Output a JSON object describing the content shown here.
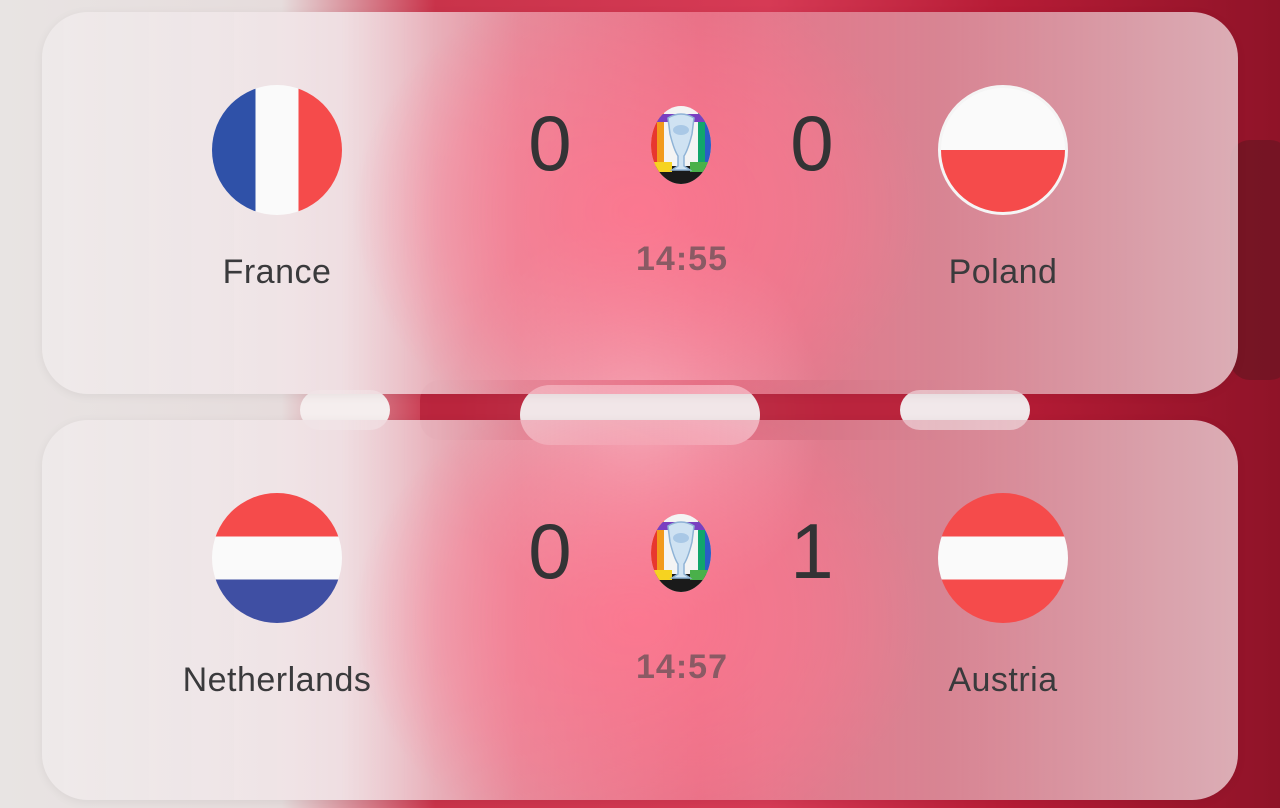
{
  "matches": [
    {
      "home": {
        "name": "France",
        "flag": "france-flag-icon",
        "score": "0"
      },
      "away": {
        "name": "Poland",
        "flag": "poland-flag-icon",
        "score": "0"
      },
      "time": "14:55",
      "competition_icon": "euro-trophy-icon"
    },
    {
      "home": {
        "name": "Netherlands",
        "flag": "netherlands-flag-icon",
        "score": "0"
      },
      "away": {
        "name": "Austria",
        "flag": "austria-flag-icon",
        "score": "1"
      },
      "time": "14:57",
      "competition_icon": "euro-trophy-icon"
    }
  ],
  "colors": {
    "flag_red": "#f54b4b",
    "flag_blue": "#2f51a8",
    "score_text": "#333335",
    "time_text": "#8a5a64"
  }
}
